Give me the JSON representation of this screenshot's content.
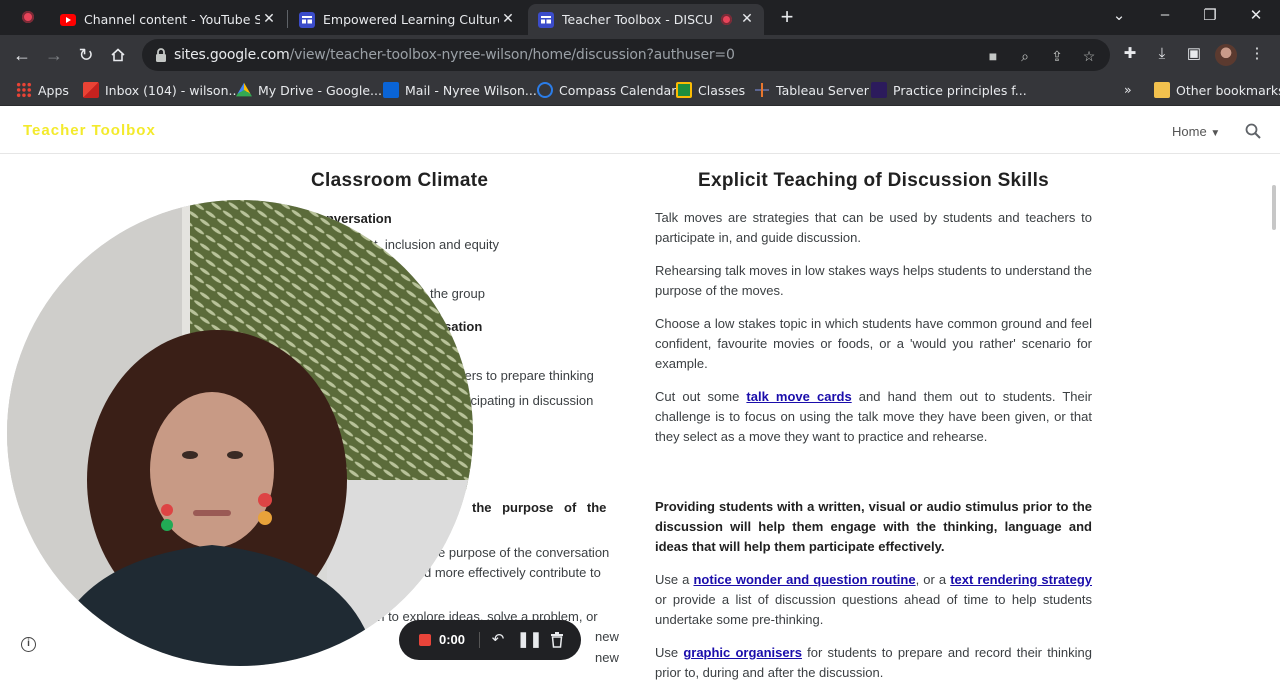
{
  "browser": {
    "tabs": [
      {
        "title": "Channel content - YouTube Studio",
        "active": false
      },
      {
        "title": "Empowered Learning Cultures",
        "active": false
      },
      {
        "title": "Teacher Toolbox - DISCUSSION",
        "active": true
      }
    ],
    "new_tab": "+",
    "url_host": "sites.google.com",
    "url_path": "/view/teacher-toolbox-nyree-wilson/home/discussion?authuser=0",
    "bookmarks": [
      {
        "label": "Apps",
        "icon": "apps-grid-icon"
      },
      {
        "label": "Inbox (104) - wilson...",
        "icon": "gmail-icon"
      },
      {
        "label": "My Drive - Google...",
        "icon": "google-drive-icon"
      },
      {
        "label": "Mail - Nyree Wilson...",
        "icon": "outlook-icon"
      },
      {
        "label": "Compass Calendar",
        "icon": "compass-icon"
      },
      {
        "label": "Classes",
        "icon": "classroom-icon"
      },
      {
        "label": "Tableau Server",
        "icon": "tableau-icon"
      },
      {
        "label": "Practice principles f...",
        "icon": "bookmark-page-icon"
      }
    ],
    "bookmarks_overflow": "»",
    "other_bookmarks": "Other bookmarks"
  },
  "site": {
    "title": "Teacher Toolbox",
    "nav_home": "Home",
    "accent": "#f3ea2c"
  },
  "left_column": {
    "heading": "Classroom Climate",
    "fragments": [
      {
        "text": "onversation",
        "bold": true
      },
      {
        "text": "t, inclusion and equity",
        "bold": false
      },
      {
        "text": "the group",
        "bold": false
      },
      {
        "text": "sation",
        "bold": true
      },
      {
        "text": "sers to prepare thinking",
        "bold": false
      },
      {
        "text": "ticipating in discussion",
        "bold": false
      },
      {
        "text": "the  purpose  of  the",
        "bold": true
      },
      {
        "text": "e purpose of the conversation",
        "bold": false
      },
      {
        "text": "d more effectively contribute to",
        "bold": false
      },
      {
        "text": "on to explore ideas, solve a problem, or",
        "bold": false
      },
      {
        "text": "new",
        "bold": false
      },
      {
        "text": "new",
        "bold": false
      }
    ]
  },
  "right_column": {
    "heading": "Explicit Teaching of Discussion Skills",
    "p1": "Talk moves are strategies that can be used by students and teachers to participate in, and guide discussion.",
    "p2": "Rehearsing talk moves in low stakes ways helps students to understand the purpose of the moves.",
    "p3": "Choose a low stakes topic in which students have common ground and feel confident, favourite movies or foods, or a 'would you rather' scenario for example.",
    "p4_before": "Cut out some ",
    "p4_link": "talk move cards",
    "p4_after": " and hand them out to students. Their challenge is to focus on using the talk move they have been given, or that they select as a move they want to practice and rehearse.",
    "p5": "Providing students with a written, visual or audio stimulus prior to the discussion will help them engage with the thinking, language and ideas that will help them participate effectively.",
    "p6_a": "Use a ",
    "p6_link1": "notice wonder and question routine",
    "p6_b": ", or a ",
    "p6_link2": "text rendering strategy",
    "p6_c": " or provide a list of discussion questions ahead of time to help students undertake some pre-thinking.",
    "p7_a": "Use ",
    "p7_link": "graphic organisers",
    "p7_b": " for students to prepare and record their thinking prior to, during and after the discussion."
  },
  "recorder": {
    "time": "0:00"
  }
}
